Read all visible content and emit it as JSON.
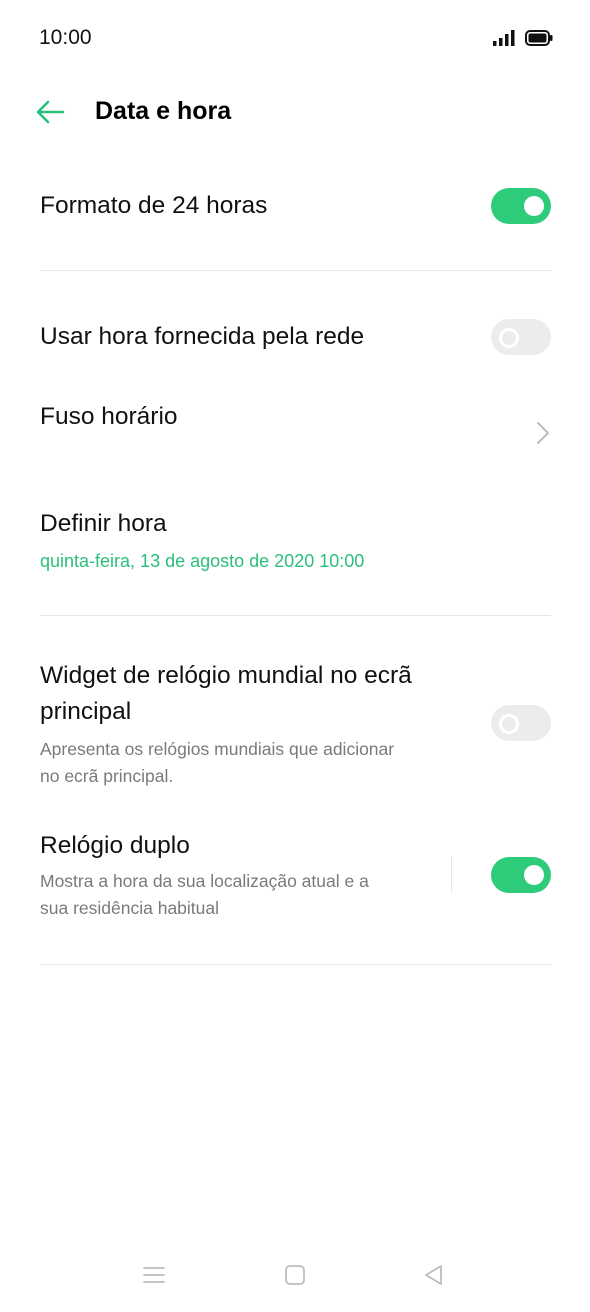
{
  "status_bar": {
    "time": "10:00"
  },
  "header": {
    "title": "Data e hora"
  },
  "settings": {
    "format24": {
      "label": "Formato de 24 horas",
      "enabled": true
    },
    "network_time": {
      "label": "Usar hora fornecida pela rede",
      "enabled": false
    },
    "timezone": {
      "label": "Fuso horário"
    },
    "set_time": {
      "label": "Definir hora",
      "value": "quinta-feira, 13 de agosto de 2020  10:00"
    },
    "world_clock": {
      "label_line1": "Widget de relógio mundial no ecrã",
      "label_line2": "principal",
      "desc_line1": "Apresenta os relógios mundiais que adicionar",
      "desc_line2": "no ecrã principal.",
      "enabled": false
    },
    "dual_clock": {
      "label": "Relógio duplo",
      "desc_line1": "Mostra a hora da sua localização atual e a",
      "desc_line2": "sua residência habitual",
      "enabled": true
    }
  },
  "colors": {
    "accent": "#2ecb7b",
    "accent_text": "#2bbf7a",
    "toggle_off": "#ececec"
  },
  "icons": {
    "back": "arrow-left-icon",
    "timezone_chevron": "chevron-right-icon",
    "nav_menu": "menu-icon",
    "nav_home": "home-square-icon",
    "nav_back": "triangle-back-icon"
  }
}
